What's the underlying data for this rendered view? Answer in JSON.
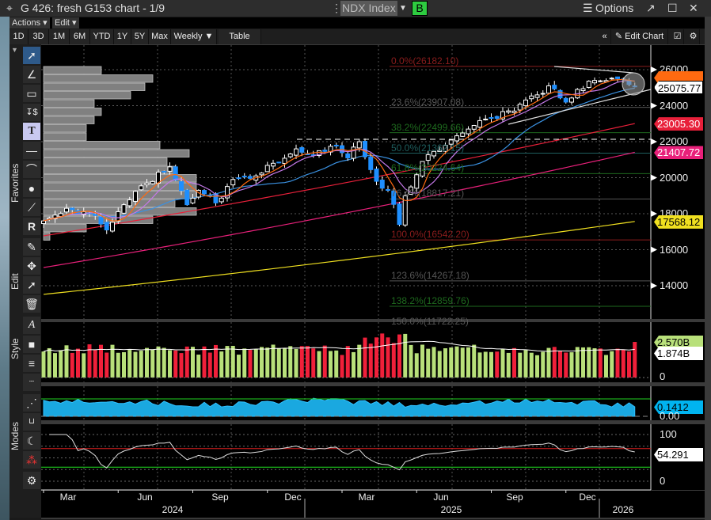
{
  "window": {
    "title": "G 426: fresh G153 chart - 1/9",
    "ticker": "NDX Index",
    "bloomberg_key": "B",
    "options_label": "Options"
  },
  "menus": {
    "actions": "Actions",
    "edit": "Edit"
  },
  "toolbar": {
    "ranges": [
      "1D",
      "3D",
      "1M",
      "6M",
      "YTD",
      "1Y",
      "5Y",
      "Max"
    ],
    "frequency": "Weekly",
    "table": "Table",
    "edit_chart": "Edit Chart"
  },
  "side_tabs": {
    "favorites": "Favorites",
    "edit": "Edit",
    "style": "Style",
    "modes": "Modes"
  },
  "colors": {
    "up": "#ffffff",
    "down": "#1e8fff",
    "ma_fast": "#ff6a10",
    "ma_mid": "#c478e8",
    "ma_slow": "#3a90e0",
    "ma_red": "#e8203a",
    "ma_magenta": "#e8207a",
    "ma_yellow": "#f0e020",
    "vol_up": "#b8e07a",
    "vol_down": "#f0203a"
  },
  "chart_data": {
    "type": "candlestick",
    "frequency": "weekly",
    "price_axis": {
      "ticks": [
        26000,
        24000,
        22000,
        20000,
        18000,
        16000,
        14000
      ]
    },
    "close_keypoints": [
      [
        0,
        17600
      ],
      [
        4,
        18300
      ],
      [
        9,
        17900
      ],
      [
        11,
        17100
      ],
      [
        14,
        18500
      ],
      [
        18,
        19700
      ],
      [
        22,
        20600
      ],
      [
        25,
        18500
      ],
      [
        27,
        19300
      ],
      [
        30,
        18600
      ],
      [
        33,
        19900
      ],
      [
        37,
        20100
      ],
      [
        40,
        20800
      ],
      [
        44,
        21600
      ],
      [
        46,
        21300
      ],
      [
        48,
        21500
      ],
      [
        51,
        21800
      ],
      [
        53,
        21100
      ],
      [
        55,
        22000
      ],
      [
        58,
        19800
      ],
      [
        60,
        19300
      ],
      [
        62,
        17400
      ],
      [
        63,
        19000
      ],
      [
        66,
        20900
      ],
      [
        70,
        21800
      ],
      [
        74,
        22700
      ],
      [
        78,
        23300
      ],
      [
        82,
        23700
      ],
      [
        86,
        24600
      ],
      [
        88,
        25100
      ],
      [
        91,
        24200
      ],
      [
        93,
        24900
      ],
      [
        96,
        25400
      ],
      [
        100,
        25500
      ],
      [
        103,
        25075.77
      ]
    ],
    "last_price": "25075.77",
    "long_mas": [
      {
        "name": "ma_red",
        "start": 16770,
        "end": 23005.3,
        "label": "23005.30"
      },
      {
        "name": "ma_magenta",
        "start": 15010,
        "end": 21407.72,
        "label": "21407.72"
      },
      {
        "name": "ma_yellow",
        "start": 13520,
        "end": 17568.12,
        "label": "17568.12"
      }
    ],
    "fibonacci": [
      {
        "label": "0.0%(26182.10)",
        "price": 26182.1,
        "color": "#8a1c1c"
      },
      {
        "label": "23.6%(23907.08)",
        "price": 23907.08,
        "color": "#555555"
      },
      {
        "label": "38.2%(22499.66)",
        "price": 22499.66,
        "color": "#1e6a1e"
      },
      {
        "label": "50.0%(21362.15)",
        "price": 21362.15,
        "color": "#1e5e5e"
      },
      {
        "label": "61.8%(20224.64)",
        "price": 20224.64,
        "color": "#1e6a1e"
      },
      {
        "label": "76.4%(18817.21)",
        "price": 18817.21,
        "color": "#555555"
      },
      {
        "label": "100.0%(16542.20)",
        "price": 16542.2,
        "color": "#8a1c1c"
      },
      {
        "label": "123.6%(14267.18)",
        "price": 14267.18,
        "color": "#555555"
      },
      {
        "label": "138.2%(12859.76)",
        "price": 12859.76,
        "color": "#1e6a1e"
      },
      {
        "label": "150.0%(11722.25)",
        "price": 11722.25,
        "color": "#555555"
      }
    ],
    "volume_profile": [
      73,
      138,
      128,
      110,
      64,
      73,
      64,
      54,
      54,
      147,
      184,
      156,
      166,
      193,
      193,
      193,
      166,
      193,
      138,
      54,
      8
    ],
    "volume": {
      "last": "2.570B",
      "average": "1.874B",
      "zero": "0",
      "last_value": 2.57,
      "avg_value": 1.874
    },
    "indicator2": {
      "last": "0.1412",
      "zero": "0.00",
      "last_value": 0.1412
    },
    "rsi": {
      "last": "54.291",
      "ticks": [
        "100",
        "0"
      ],
      "upper": 70,
      "lower": 30
    },
    "x_axis": {
      "months": [
        "Mar",
        "Jun",
        "Sep",
        "Dec",
        "Mar",
        "Jun",
        "Sep",
        "Dec"
      ],
      "years": [
        "2024",
        "2025",
        "2026"
      ]
    }
  }
}
